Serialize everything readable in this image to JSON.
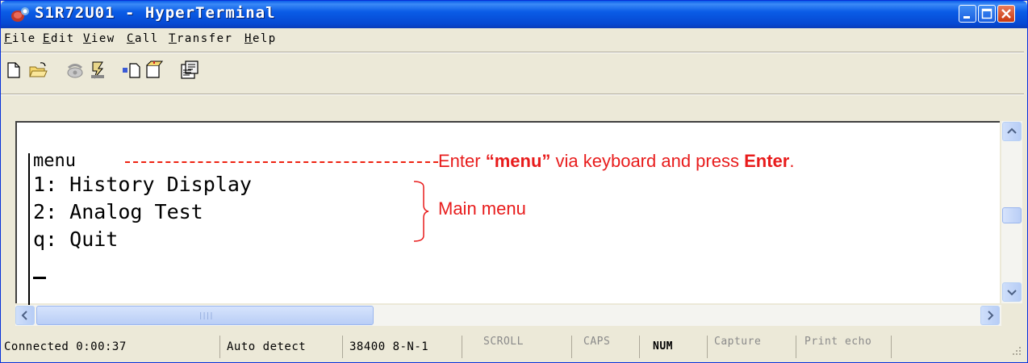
{
  "window": {
    "title": "S1R72U01 - HyperTerminal"
  },
  "menubar": {
    "items": [
      {
        "label": "File",
        "underline": "F"
      },
      {
        "label": "Edit",
        "underline": "E"
      },
      {
        "label": "View",
        "underline": "V"
      },
      {
        "label": "Call",
        "underline": "C"
      },
      {
        "label": "Transfer",
        "underline": "T"
      },
      {
        "label": "Help",
        "underline": "H"
      }
    ]
  },
  "toolbar": {
    "icons": [
      "new-connection-icon",
      "open-icon",
      "disconnect-phone-icon",
      "dial-icon",
      "send-file-icon",
      "receive-file-icon",
      "properties-icon"
    ]
  },
  "terminal": {
    "lines": [
      "menu",
      "1: History Display",
      "2: Analog Test",
      "q: Quit"
    ]
  },
  "annotations": {
    "enter_prefix": "Enter ",
    "enter_quote": "“menu”",
    "enter_middle": " via keyboard and press ",
    "enter_key": "Enter",
    "enter_suffix": ".",
    "main_menu": "Main menu",
    "color": "#e81c1c"
  },
  "statusbar": {
    "connected": "Connected 0:00:37",
    "detect": "Auto detect",
    "port": "38400 8-N-1",
    "scroll": "SCROLL",
    "caps": "CAPS",
    "num": "NUM",
    "capture": "Capture",
    "print_echo": "Print echo"
  }
}
